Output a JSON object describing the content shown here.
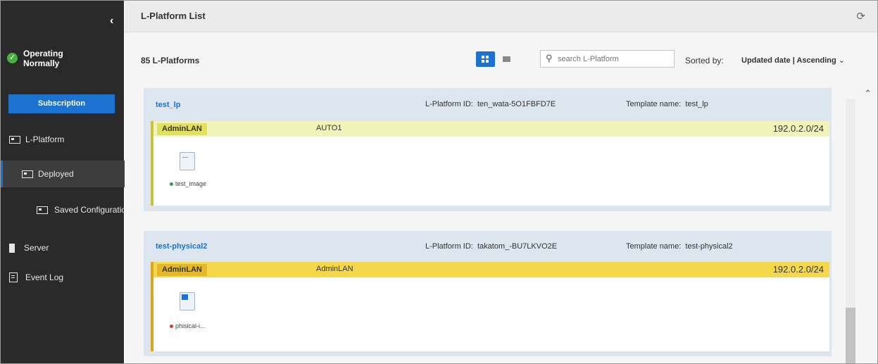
{
  "sidebar": {
    "collapse_icon": "chevron-left-icon",
    "status": {
      "label": "Operating Normally",
      "icon": "check-circle-icon",
      "color": "#49b040"
    },
    "subscription_label": "Subscription",
    "nav": {
      "lplatform": "L-Platform",
      "deployed": "Deployed",
      "saved": "Saved Configurations",
      "server": "Server",
      "event_log": "Event Log"
    }
  },
  "header": {
    "title": "L-Platform List",
    "refresh_icon": "refresh-icon"
  },
  "toolbar": {
    "count": "85 L-Platforms",
    "search_placeholder": "search L-Platform",
    "sorted_label": "Sorted by:",
    "sorted_value": "Updated date | Ascending",
    "accent": "#1b73cf"
  },
  "platforms": [
    {
      "name": "test_lp",
      "id_label": "L-Platform ID:",
      "id": "ten_wata-5O1FBFD7E",
      "template_label": "Template name:",
      "template": "test_lp",
      "network": {
        "tag": "AdminLAN",
        "name": "AUTO1",
        "address": "192.0.2.0/24",
        "bar_color": "#f1f4b6",
        "tag_color": "#e3e05a",
        "edge_color": "#c8c43a"
      },
      "server": {
        "label": "test_image",
        "status_color": "#2e9f4a"
      }
    },
    {
      "name": "test-physical2",
      "id_label": "L-Platform ID:",
      "id": "takatom_-BU7LKVO2E",
      "template_label": "Template name:",
      "template": "test-physical2",
      "network": {
        "tag": "AdminLAN",
        "name": "AdminLAN",
        "address": "192.0.2.0/24",
        "bar_color": "#f4d84a",
        "tag_color": "#e4b82a",
        "edge_color": "#d8a81f"
      },
      "server": {
        "label": "phisical-i...",
        "status_color": "#e0382c"
      }
    }
  ]
}
